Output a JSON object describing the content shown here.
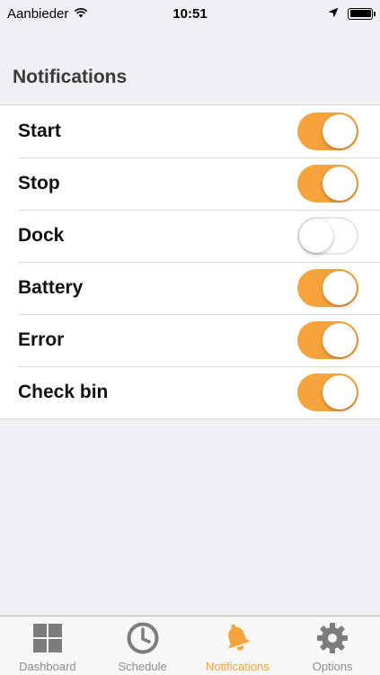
{
  "status_bar": {
    "carrier": "Aanbieder",
    "time": "10:51"
  },
  "section": {
    "title": "Notifications"
  },
  "settings": [
    {
      "label": "Start",
      "enabled": true
    },
    {
      "label": "Stop",
      "enabled": true
    },
    {
      "label": "Dock",
      "enabled": false
    },
    {
      "label": "Battery",
      "enabled": true
    },
    {
      "label": "Error",
      "enabled": true
    },
    {
      "label": "Check bin",
      "enabled": true
    }
  ],
  "tab_bar": {
    "tabs": [
      {
        "label": "Dashboard",
        "icon": "dashboard-grid-icon",
        "active": false
      },
      {
        "label": "Schedule",
        "icon": "clock-icon",
        "active": false
      },
      {
        "label": "Notifications",
        "icon": "bell-icon",
        "active": true
      },
      {
        "label": "Options",
        "icon": "gear-icon",
        "active": false
      }
    ]
  },
  "colors": {
    "accent": "#f7a33b",
    "inactive_tab": "#8e8e8e",
    "background": "#efeff4"
  }
}
